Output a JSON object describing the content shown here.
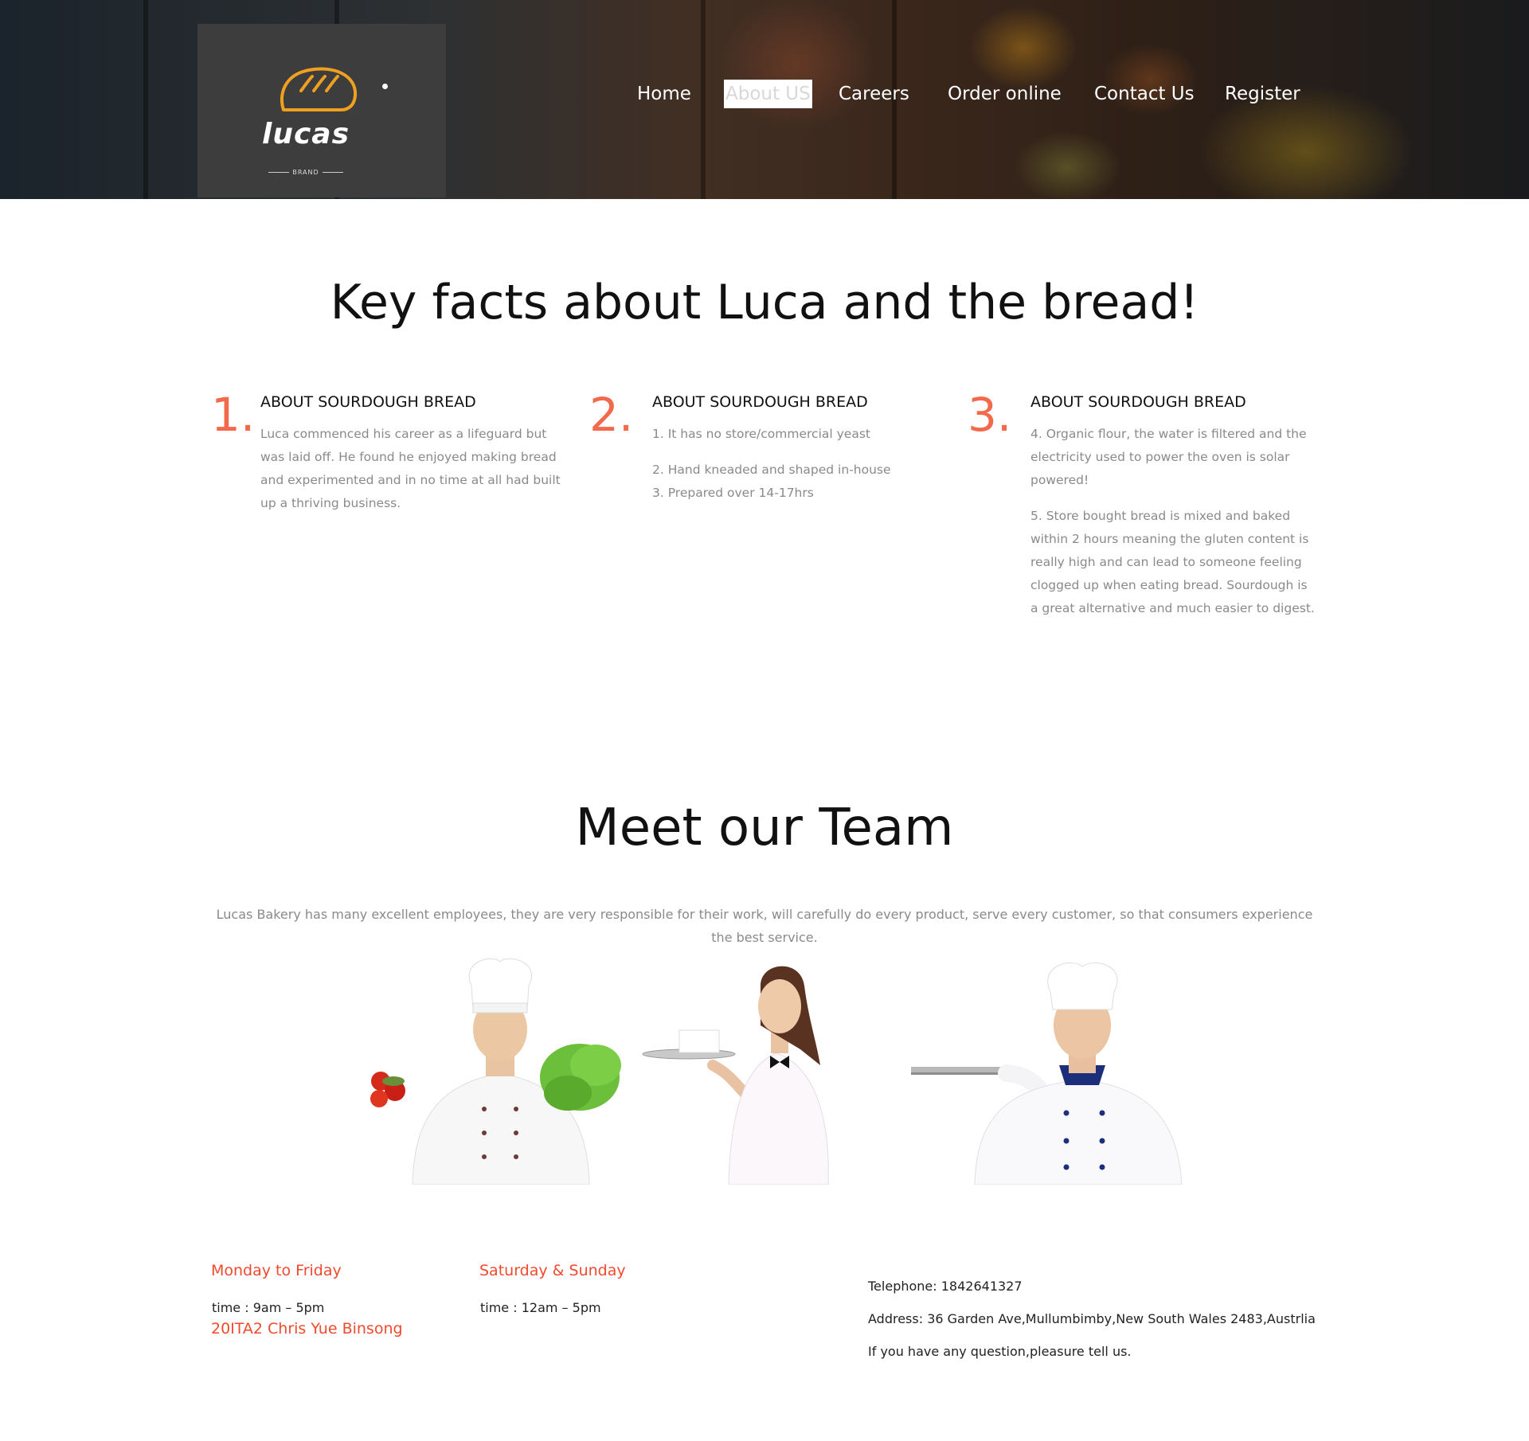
{
  "header": {
    "logo": {
      "name": "lucas",
      "tagline": "BRAND"
    },
    "nav": [
      "Home",
      "About US",
      "Careers",
      "Order online",
      "Contact Us",
      "Register"
    ],
    "active_nav": "About US"
  },
  "facts": {
    "title": "Key facts about Luca and the bread!",
    "items": [
      {
        "number": "1.",
        "heading": "ABOUT SOURDOUGH BREAD",
        "paragraphs": [
          "Luca commenced his career as a lifeguard but was laid off. He found he enjoyed making bread and experimented and in no time at all had built up a thriving business."
        ]
      },
      {
        "number": "2.",
        "heading": "ABOUT SOURDOUGH BREAD",
        "paragraphs": [
          "1. It has no store/commercial yeast",
          "2. Hand kneaded and shaped in-house",
          "3. Prepared over 14-17hrs"
        ]
      },
      {
        "number": "3.",
        "heading": "ABOUT SOURDOUGH BREAD",
        "paragraphs": [
          "4. Organic flour, the water is filtered and the electricity used to power the oven is solar powered!",
          "5. Store bought bread is mixed and baked within 2 hours meaning the gluten content is really high and can lead to someone feeling clogged up when eating bread. Sourdough is a great alternative and much easier to digest."
        ]
      }
    ]
  },
  "team": {
    "title": "Meet our Team",
    "description": "Lucas Bakery has many excellent employees, they are very responsible for their work, will carefully do every product, serve every customer, so that consumers experience the best service.",
    "members": [
      {
        "role": "chef-with-vegetables"
      },
      {
        "role": "waitress-with-tray"
      },
      {
        "role": "chef-with-tray"
      }
    ]
  },
  "footer": {
    "weekday": {
      "label": "Monday to Friday",
      "time": "time : 9am – 5pm"
    },
    "weekend": {
      "label": "Saturday & Sunday",
      "time": "time : 12am – 5pm"
    },
    "credit": "20ITA2 Chris Yue Binsong",
    "contact": {
      "telephone": "Telephone: 1842641327",
      "address": "Address: 36 Garden Ave,Mullumbimby,New South Wales 2483,Austrlia",
      "note": "If you have any question,pleasure tell us."
    }
  },
  "colors": {
    "accent": "#f26a4b",
    "footer_label": "#f04a2e",
    "logo_orange": "#f0a020",
    "logo_box": "#3d3d3d"
  }
}
